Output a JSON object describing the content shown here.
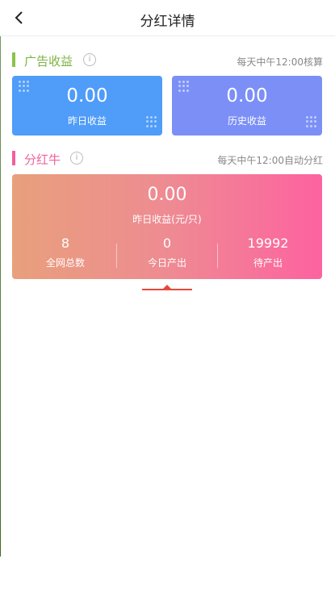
{
  "header": {
    "title": "分红详情"
  },
  "ad_income": {
    "title": "广告收益",
    "note": "每天中午12:00核算",
    "accent": "#8bc34a",
    "cards": [
      {
        "value": "0.00",
        "label": "昨日收益",
        "color": "#4f9cf9"
      },
      {
        "value": "0.00",
        "label": "历史收益",
        "color": "#7b8ff7"
      }
    ]
  },
  "dividend_cow": {
    "title": "分红牛",
    "note": "每天中午12:00自动分红",
    "accent": "#f2609d",
    "yesterday_value": "0.00",
    "yesterday_label": "昨日收益(元/只)",
    "stats": [
      {
        "value": "8",
        "label": "全网总数"
      },
      {
        "value": "0",
        "label": "今日产出"
      },
      {
        "value": "19992",
        "label": "待产出"
      }
    ]
  },
  "icons": {
    "back": "chevron-left-icon",
    "info": "info-icon",
    "decor": "dot-grid-icon"
  }
}
